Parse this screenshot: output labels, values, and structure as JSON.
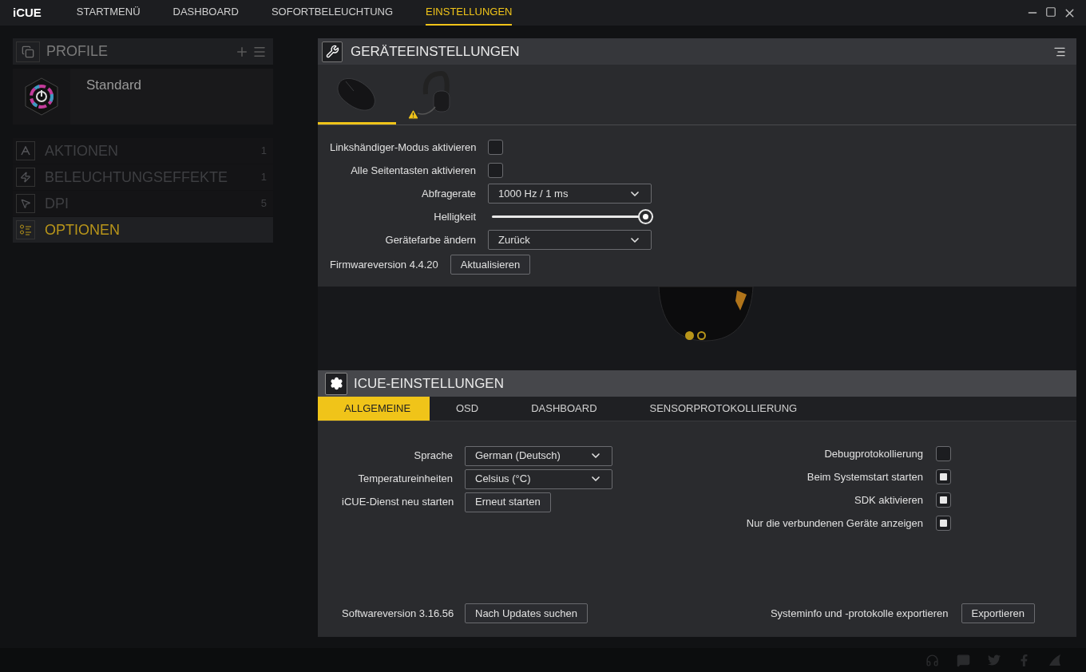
{
  "app_name": "iCUE",
  "nav": [
    {
      "label": "STARTMENÜ",
      "selected": false
    },
    {
      "label": "DASHBOARD",
      "selected": false
    },
    {
      "label": "SOFORTBELEUCHTUNG",
      "selected": false
    },
    {
      "label": "EINSTELLUNGEN",
      "selected": true
    }
  ],
  "sidebar": {
    "profiles_title": "PROFILE",
    "profiles": [
      {
        "name": "Standard"
      }
    ],
    "sections": [
      {
        "kind": "actions",
        "label": "AKTIONEN",
        "count": "1",
        "selected": false
      },
      {
        "kind": "lighting",
        "label": "BELEUCHTUNGSEFFEKTE",
        "count": "1",
        "selected": false
      },
      {
        "kind": "dpi",
        "label": "DPI",
        "count": "5",
        "selected": false
      },
      {
        "kind": "options",
        "label": "OPTIONEN",
        "selected": true
      }
    ]
  },
  "device_settings": {
    "title": "GERÄTEEINSTELLUNGEN",
    "devices": [
      {
        "kind": "mouse",
        "selected": true,
        "warning": false
      },
      {
        "kind": "headset",
        "selected": false,
        "warning": true
      }
    ],
    "rows": [
      {
        "kind": "checkbox",
        "label": "Linkshändiger-Modus aktivieren",
        "checked": false
      },
      {
        "kind": "checkbox",
        "label": "Alle Seitentasten aktivieren",
        "checked": false
      },
      {
        "kind": "dropdown",
        "label": "Abfragerate",
        "value": "1000 Hz / 1 ms"
      },
      {
        "kind": "slider",
        "label": "Helligkeit",
        "level": 1
      },
      {
        "kind": "dropdown",
        "label": "Gerätefarbe ändern",
        "value": "Zurück"
      }
    ],
    "firmware_label": "Firmwareversion 4.4.20",
    "firmware_button": "Aktualisieren",
    "pager": [
      {
        "selected": true
      },
      {
        "selected": false
      }
    ]
  },
  "icue_settings": {
    "title": "ICUE-EINSTELLUNGEN",
    "tabs": [
      {
        "label": "ALLGEMEINE",
        "selected": true
      },
      {
        "label": "OSD",
        "selected": false
      },
      {
        "label": "DASHBOARD",
        "selected": false
      },
      {
        "label": "SENSORPROTOKOLLIERUNG",
        "selected": false
      }
    ],
    "left_rows": [
      {
        "kind": "dropdown",
        "label": "Sprache",
        "value": "German (Deutsch)"
      },
      {
        "kind": "dropdown",
        "label": "Temperatureinheiten",
        "value": "Celsius (°C)"
      },
      {
        "kind": "button",
        "label": "iCUE-Dienst neu starten",
        "value": "Erneut starten"
      }
    ],
    "right_rows": [
      {
        "label": "Debugprotokollierung",
        "checked": false
      },
      {
        "label": "Beim Systemstart starten",
        "checked": true
      },
      {
        "label": "SDK aktivieren",
        "checked": true
      },
      {
        "label": "Nur die verbundenen Geräte anzeigen",
        "checked": true
      }
    ],
    "software_label": "Softwareversion 3.16.56",
    "software_button": "Nach Updates suchen",
    "export_label": "Systeminfo und -protokolle exportieren",
    "export_button": "Exportieren"
  }
}
